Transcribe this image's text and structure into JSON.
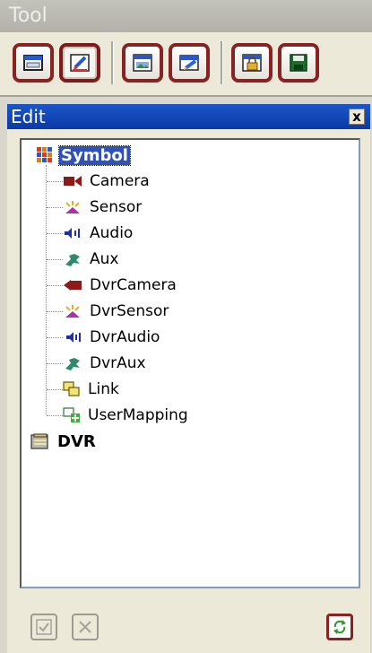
{
  "tool": {
    "title": "Tool"
  },
  "edit": {
    "title": "Edit",
    "close_label": "x"
  },
  "toolbar": {
    "buttons": [
      {
        "icon": "window-icon"
      },
      {
        "icon": "edit-window-icon",
        "active": true
      },
      {
        "icon": "image-window-icon"
      },
      {
        "icon": "edit-pencil-icon"
      },
      {
        "icon": "lock-icon"
      },
      {
        "icon": "save-icon"
      }
    ]
  },
  "tree": {
    "root": {
      "label": "Symbol"
    },
    "children": [
      {
        "label": "Camera",
        "icon": "camera-icon"
      },
      {
        "label": "Sensor",
        "icon": "sensor-icon"
      },
      {
        "label": "Audio",
        "icon": "audio-icon"
      },
      {
        "label": "Aux",
        "icon": "aux-icon"
      },
      {
        "label": "DvrCamera",
        "icon": "dvr-camera-icon"
      },
      {
        "label": "DvrSensor",
        "icon": "dvr-sensor-icon"
      },
      {
        "label": "DvrAudio",
        "icon": "dvr-audio-icon"
      },
      {
        "label": "DvrAux",
        "icon": "dvr-aux-icon"
      },
      {
        "label": "Link",
        "icon": "link-icon"
      },
      {
        "label": "UserMapping",
        "icon": "user-mapping-icon"
      }
    ],
    "dvr": {
      "label": "DVR"
    }
  },
  "colors": {
    "accent": "#8a2222",
    "selection": "#2f52b8",
    "title_active": "#0a3aa6"
  }
}
